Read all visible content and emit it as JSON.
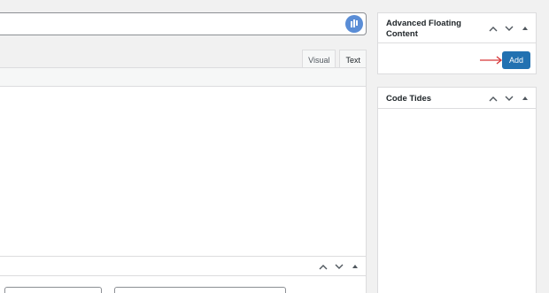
{
  "editor": {
    "tabs": [
      {
        "label": "Visual",
        "active": false
      },
      {
        "label": "Text",
        "active": true
      }
    ]
  },
  "sidebar": {
    "advanced_floating_content": {
      "title": "Advanced Floating Content",
      "add_label": "Add",
      "add_color": "#2271b1",
      "arrow_color": "#d63638"
    },
    "code_tides": {
      "title": "Code Tides"
    }
  }
}
